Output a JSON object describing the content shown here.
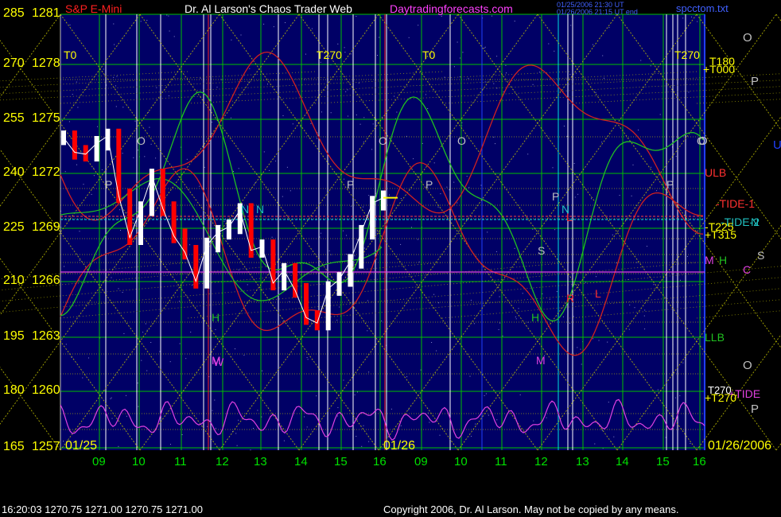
{
  "header": {
    "instrument": "S&P E-Mini",
    "site_title": "Dr. Al Larson's Chaos Trader Web",
    "site_url": "Daytradingforecasts.com",
    "timestamp_line1": "01/25/2006 21:30 UT",
    "timestamp_line2": "01/26/2006 21:15 UT end",
    "filename": "spcctom.txt"
  },
  "footer": {
    "quote": "16:20:03  1270.75 1271.00 1270.75 1271.00",
    "copyright": "Copyright 2006, Dr. Al Larson. May not be copied by any means."
  },
  "dates": {
    "start": "01/25",
    "middle": "01/26",
    "end": "01/26/2006"
  },
  "colors": {
    "background": "#000066",
    "grid_green": "#00c000",
    "grid_yellow": "#c8c800",
    "axis_label_green": "#00e000",
    "axis_label_yellow": "#ffff00",
    "price_up": "#ffffff",
    "price_down": "#ff0000",
    "tide_red": "#d02020",
    "tide_green": "#20c020",
    "oscillator": "#e040e0",
    "cyan": "#00e0e0"
  },
  "chart_data": {
    "type": "line",
    "title": "S&P E-Mini",
    "y_left_outer_ticks": [
      "285",
      "270",
      "255",
      "240",
      "225",
      "210",
      "195",
      "180",
      "165"
    ],
    "y_left_inner_ticks": [
      "1281",
      "1278",
      "1275",
      "1272",
      "1269",
      "1266",
      "1263",
      "1260",
      "1257"
    ],
    "ylim": [
      1257,
      1281
    ],
    "x_ticks": [
      "09",
      "10",
      "11",
      "12",
      "13",
      "14",
      "15",
      "16",
      "09",
      "10",
      "11",
      "12",
      "13",
      "14",
      "15",
      "16"
    ],
    "top_markers": [
      "T0",
      "T270",
      "T0",
      "T270",
      "T180"
    ],
    "right_labels": {
      "T180": "T180",
      "T000": "+T000",
      "ULB": "ULB",
      "TIDE1": "-TIDE-1",
      "TIDE2": "-TIDE-2",
      "N": "N",
      "T225": "-T225",
      "T315": "+T315",
      "M": "M",
      "H": "H",
      "C": "C",
      "S": "S",
      "LLB": "LLB",
      "T270a": "T270",
      "TIDE": "+TIDE",
      "T270b": "+T270",
      "O1": "O",
      "P1": "P",
      "O2": "O",
      "U": "U",
      "O3": "O",
      "P2": "P"
    },
    "chart_letters": [
      "P",
      "O",
      "P",
      "O",
      "P",
      "O",
      "P",
      "O",
      "P",
      "H",
      "N",
      "N",
      "M",
      "S",
      "M",
      "H",
      "N",
      "W",
      "L",
      "L",
      "R"
    ],
    "price_series": {
      "name": "S&P E-Mini",
      "x": [
        "01/25 08:30",
        "09:00",
        "09:30",
        "09:45",
        "10:00",
        "10:15",
        "10:30",
        "10:45",
        "11:00",
        "11:15",
        "11:30",
        "11:45",
        "12:00",
        "12:15",
        "12:30",
        "12:45",
        "13:00",
        "13:15",
        "13:30",
        "13:45",
        "14:00",
        "14:15",
        "14:30",
        "14:45",
        "15:00",
        "15:15",
        "15:30",
        "15:45",
        "16:00",
        "16:15"
      ],
      "values": [
        1274.2,
        1273.4,
        1273.3,
        1273.9,
        1274.3,
        1271.0,
        1268.7,
        1270.3,
        1272.1,
        1270.3,
        1268.8,
        1267.9,
        1266.3,
        1268.3,
        1269.0,
        1269.3,
        1270.2,
        1268.0,
        1268.2,
        1266.2,
        1266.9,
        1265.8,
        1264.3,
        1264.0,
        1265.9,
        1266.4,
        1267.4,
        1269.0,
        1270.6,
        1270.9
      ]
    }
  }
}
